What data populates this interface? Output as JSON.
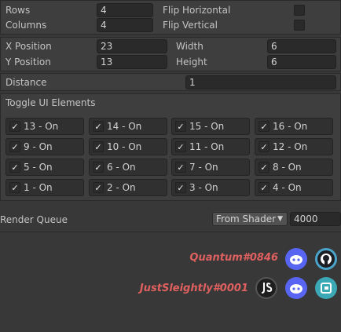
{
  "grid": {
    "rows_label": "Rows",
    "rows_value": "4",
    "columns_label": "Columns",
    "columns_value": "4",
    "flip_horizontal_label": "Flip Horizontal",
    "flip_vertical_label": "Flip Vertical"
  },
  "position": {
    "x_label": "X Position",
    "x_value": "23",
    "y_label": "Y Position",
    "y_value": "13",
    "width_label": "Width",
    "width_value": "6",
    "height_label": "Height",
    "height_value": "6"
  },
  "distance": {
    "label": "Distance",
    "value": "1"
  },
  "toggles": {
    "title": "Toggle UI Elements",
    "items": [
      "13 - On",
      "14 - On",
      "15 - On",
      "16 - On",
      "9 - On",
      "10 - On",
      "11 - On",
      "12 - On",
      "5 - On",
      "6 - On",
      "7 - On",
      "8 - On",
      "1 - On",
      "2 - On",
      "3 - On",
      "4 - On"
    ]
  },
  "render_queue": {
    "label": "Render Queue",
    "mode": "From Shader",
    "value": "4000"
  },
  "credits": {
    "author1": "Quantum#0846",
    "author2": "JustSleightly#0001"
  },
  "icons": {
    "discord": "discord-icon",
    "github": "github-icon",
    "js_logo": "js-logo-icon",
    "booth": "booth-icon"
  },
  "colors": {
    "background": "#383838",
    "credit_text": "#e06060",
    "discord": "#5865f2",
    "github_ring": "#4aa3c8",
    "booth": "#3aa9b5"
  }
}
